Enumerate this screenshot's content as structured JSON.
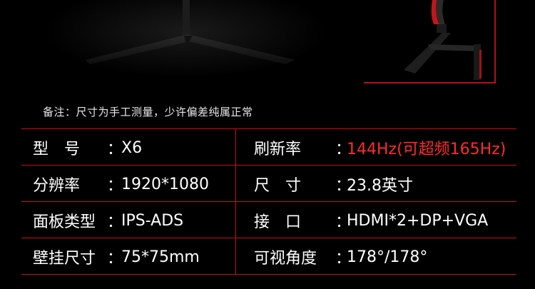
{
  "note": "备注：尺寸为手工测量，少许偏差纯属正常",
  "colors": {
    "accent": "#c41218",
    "highlight": "#ff2a2a"
  },
  "specs": {
    "row0": {
      "left_label": "型　号",
      "left_value": "X6",
      "right_label": "刷新率",
      "right_value": "144Hz(可超频165Hz)"
    },
    "row1": {
      "left_label": "分辨率",
      "left_value": "1920*1080",
      "right_label": "尺　寸",
      "right_value": "23.8英寸"
    },
    "row2": {
      "left_label": "面板类型",
      "left_value": "IPS-ADS",
      "right_label": "接　口",
      "right_value": "HDMI*2+DP+VGA"
    },
    "row3": {
      "left_label": "壁挂尺寸",
      "left_value": "75*75mm",
      "right_label": "可视角度",
      "right_value": "178°/178°"
    }
  },
  "colon": "："
}
